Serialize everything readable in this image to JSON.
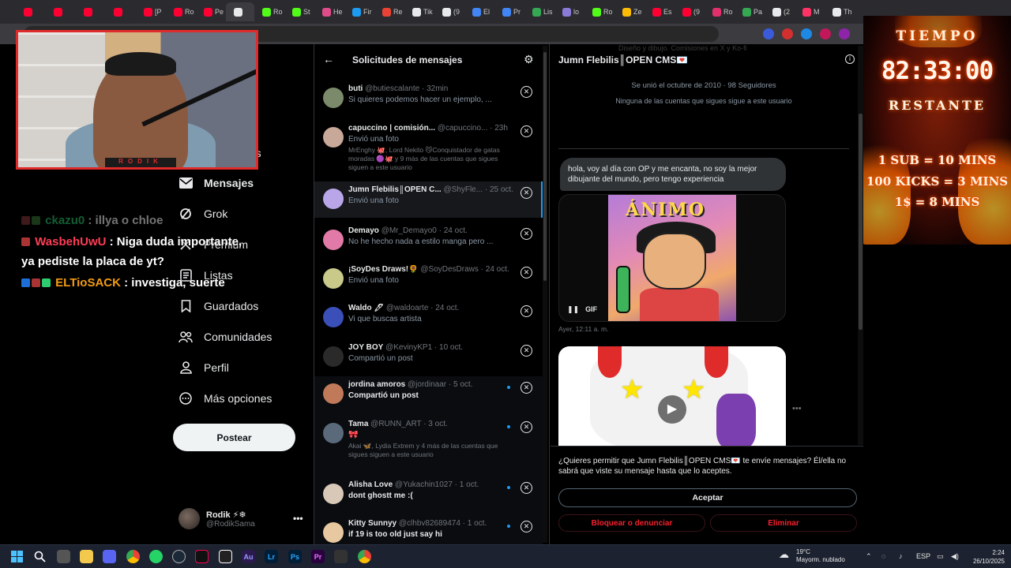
{
  "browser": {
    "tabs": [
      {
        "label": "",
        "color": "#ff0033"
      },
      {
        "label": "",
        "color": "#ff0033"
      },
      {
        "label": "",
        "color": "#ff0033"
      },
      {
        "label": "",
        "color": "#ff0033"
      },
      {
        "label": "[P",
        "color": "#ff0033"
      },
      {
        "label": "Ro",
        "color": "#ff0033"
      },
      {
        "label": "Pe",
        "color": "#ff0033"
      },
      {
        "label": "",
        "color": "#e7e9ea"
      },
      {
        "label": "Ro",
        "color": "#53fc18"
      },
      {
        "label": "St",
        "color": "#53fc18"
      },
      {
        "label": "He",
        "color": "#e04c8a"
      },
      {
        "label": "Fir",
        "color": "#1d9bf0"
      },
      {
        "label": "Re",
        "color": "#ea4335"
      },
      {
        "label": "Tik",
        "color": "#e7e9ea"
      },
      {
        "label": "(9",
        "color": "#e7e9ea"
      },
      {
        "label": "El",
        "color": "#4285f4"
      },
      {
        "label": "Pr",
        "color": "#4285f4"
      },
      {
        "label": "Lis",
        "color": "#34a853"
      },
      {
        "label": "lo",
        "color": "#8a7bd8"
      },
      {
        "label": "Ro",
        "color": "#53fc18"
      },
      {
        "label": "Ze",
        "color": "#fbbc05"
      },
      {
        "label": "Es",
        "color": "#ff0033"
      },
      {
        "label": "(9",
        "color": "#ff0033"
      },
      {
        "label": "Ro",
        "color": "#e1306c"
      },
      {
        "label": "Pa",
        "color": "#34a853"
      },
      {
        "label": "(2",
        "color": "#e7e9ea"
      },
      {
        "label": "M",
        "color": "#ff3366"
      },
      {
        "label": "Th",
        "color": "#e7e9ea"
      }
    ]
  },
  "nav": {
    "partial_label": "nes",
    "items": [
      {
        "label": "Mensajes",
        "icon": "mail-icon",
        "bold": true
      },
      {
        "label": "Grok",
        "icon": "grok-icon",
        "bold": false
      },
      {
        "label": "Premium",
        "icon": "premium-icon",
        "bold": false
      },
      {
        "label": "Listas",
        "icon": "list-icon",
        "bold": false
      },
      {
        "label": "Guardados",
        "icon": "bookmark-icon",
        "bold": false
      },
      {
        "label": "Comunidades",
        "icon": "communities-icon",
        "bold": false
      },
      {
        "label": "Perfil",
        "icon": "profile-icon",
        "bold": false
      },
      {
        "label": "Más opciones",
        "icon": "more-options-icon",
        "bold": false
      }
    ],
    "post_label": "Postear",
    "account": {
      "name": "Rodik ⚡❄",
      "handle": "@RodikSama",
      "more": "•••"
    }
  },
  "chat": [
    {
      "user": "ckazu0",
      "message": " : illya o chloe"
    },
    {
      "user": "WasbehUwU",
      "message": " : Niga duda importante,",
      "message2": "ya pediste la placa de yt?"
    },
    {
      "user": "ELTioSACK",
      "message": " : investiga, suerte"
    }
  ],
  "webcam": {
    "label": "RODIK"
  },
  "requests": {
    "title": "Solicitudes de mensajes",
    "back": "←",
    "gear": "⚙",
    "items": [
      {
        "name": "buti",
        "handle": "@butiescalante · 32min",
        "preview": "Si quieres podemos hacer un ejemplo, ...",
        "extra": "",
        "color": "#7a8a6a",
        "state": "read"
      },
      {
        "name": "capuccino | comisión...",
        "handle": "@capuccino... · 23h",
        "preview": "Envió una foto",
        "extra": "MrEnghy 🐙, Lord Nekito 😼Conquistador de gatas moradas 🟣🐙 y 9 más de las cuentas que sigues siguen a este usuario",
        "color": "#c8a898",
        "state": "read"
      },
      {
        "name": "Jumn Flebilis║OPEN C...",
        "handle": "@ShyFle... · 25 oct.",
        "preview": "Envió una foto",
        "extra": "",
        "color": "#b9a6e8",
        "state": "selected"
      },
      {
        "name": "Demayo",
        "handle": "@Mr_Demayo0 · 24 oct.",
        "preview": "No he hecho nada a estilo manga pero ...",
        "extra": "",
        "color": "#e27aa8",
        "state": "read"
      },
      {
        "name": "¡SoyDes Draws!🌻",
        "handle": "@SoyDesDraws · 24 oct.",
        "preview": "Envió una foto",
        "extra": "",
        "color": "#c9c98a",
        "state": "read"
      },
      {
        "name": "Waldo 🖊",
        "handle": "@waldoarte · 24 oct.",
        "preview": "Vi que buscas artista",
        "extra": "",
        "color": "#3a4fb8",
        "state": "read"
      },
      {
        "name": "JOY BOY",
        "handle": "@KevinyKP1 · 10 oct.",
        "preview": "Compartió un post",
        "extra": "",
        "color": "#2a2a2a",
        "state": "read"
      },
      {
        "name": "jordina amoros",
        "handle": "@jordinaar · 5 oct.",
        "preview": "Compartió un post",
        "extra": "",
        "color": "#c07a5a",
        "state": "unread"
      },
      {
        "name": "Tama",
        "handle": "@RUNN_ART · 3 oct.",
        "preview": "🎀",
        "extra": "Akai 🦋, Lydia Extrem y 4 más de las cuentas que sigues siguen a este usuario",
        "color": "#5a6a7a",
        "state": "unread"
      },
      {
        "name": "Alisha Love",
        "handle": "@Yukachin1027 · 1 oct.",
        "preview": "dont ghostt me :(",
        "extra": "",
        "color": "#d8c8b8",
        "state": "unread"
      },
      {
        "name": "Kitty Sunnyy",
        "handle": "@clhbv82689474 · 1 oct.",
        "preview": "if 19 is too old just say hi",
        "extra": "",
        "color": "#e8c8a0",
        "state": "unread"
      }
    ]
  },
  "conversation": {
    "name": "Jumn Flebilis║OPEN CMS💌",
    "ghost_text": "Diseño y dibujo. Comisiones en X y Ko-fi",
    "joined": "Se unió el octubre de 2010 · 98 Seguidores",
    "no_follow": "Ninguna de las cuentas que sigues sigue a este usuario",
    "message": "hola, voy al día con OP y me encanta, no soy la mejor dibujante del mundo, pero tengo experiencia",
    "gif_text": "ÁNIMO",
    "gif_pause": "❚❚",
    "gif_label": "GIF",
    "gif_time": "Ayer, 12:11 a. m.",
    "more": "•••",
    "accept_question": "¿Quieres permitir que Jumn Flebilis║OPEN CMS💌 te envíe mensajes? Él/ella no sabrá que viste su mensaje hasta que lo aceptes.",
    "accept_label": "Aceptar",
    "block_label": "Bloquear o denunciar",
    "delete_label": "Eliminar"
  },
  "timer": {
    "title": "TIEMPO",
    "clock": "82:33:00",
    "subtitle": "RESTANTE",
    "rules": [
      "1 SUB = 10 MINS",
      "100 KICKS = 3 MINS",
      "1$ = 8 MINS"
    ]
  },
  "taskbar": {
    "weather_temp": "19°C",
    "weather_desc": "Mayorm. nublado",
    "lang": "ESP",
    "time": "2:24",
    "date": "26/10/2025"
  }
}
